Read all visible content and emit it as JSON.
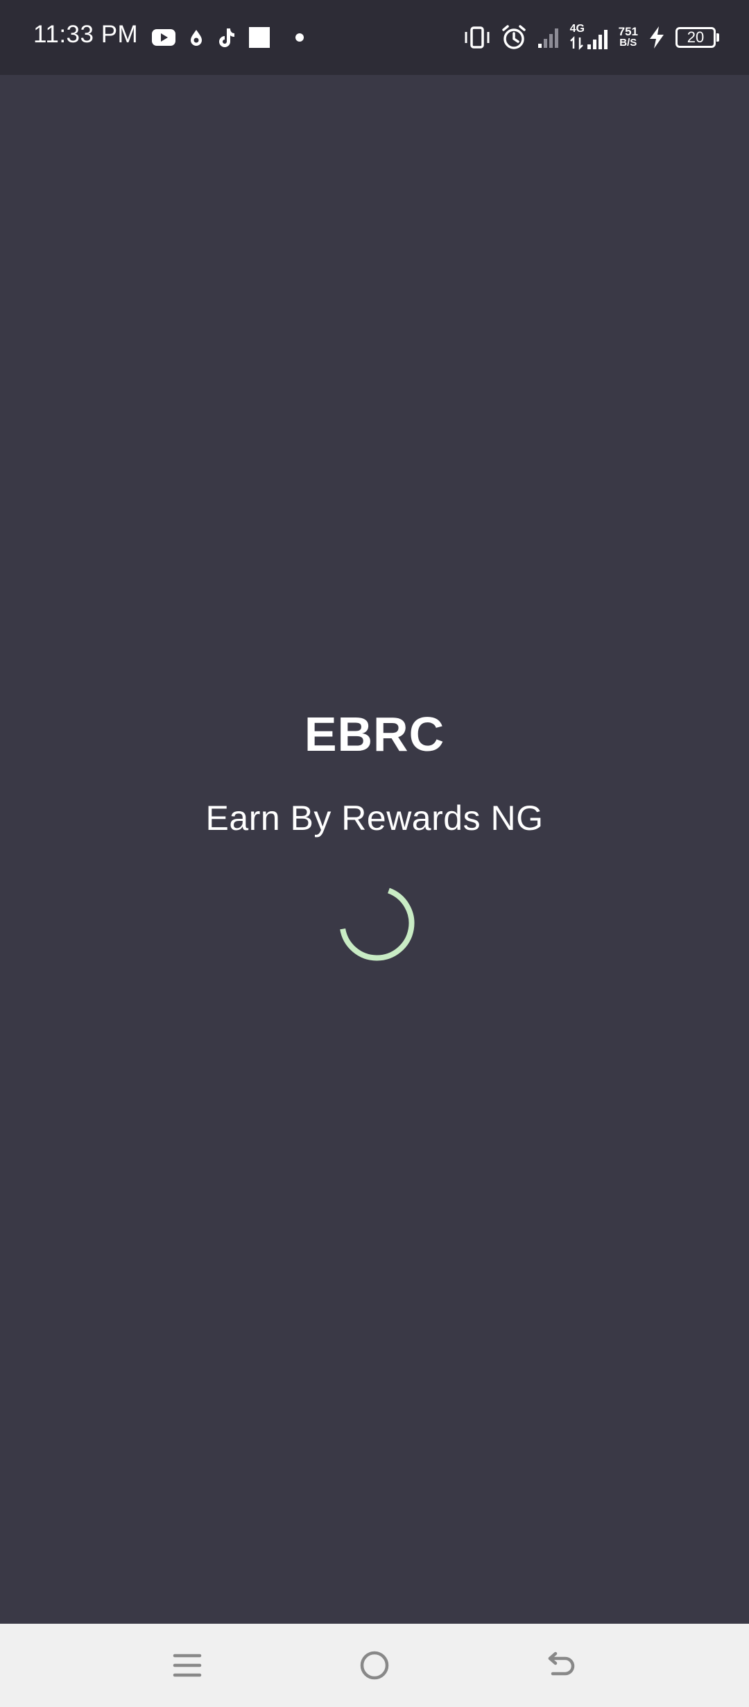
{
  "status_bar": {
    "time": "11:33 PM",
    "network_type": "4G",
    "speed_value": "751",
    "speed_unit": "B/S",
    "battery_level": "20",
    "left_icons": [
      "youtube-icon",
      "notification-drop-icon",
      "tiktok-icon",
      "square-app-icon",
      "more-dot-icon"
    ],
    "right_icons": [
      "vibrate-icon",
      "alarm-icon",
      "signal-icon",
      "signal-4g-icon",
      "charging-icon",
      "battery-icon"
    ]
  },
  "splash": {
    "title": "EBRC",
    "subtitle": "Earn By Rewards NG",
    "spinner_color": "#c9ecc5"
  },
  "nav_bar": {
    "buttons": [
      "menu-icon",
      "home-icon",
      "back-icon"
    ]
  },
  "colors": {
    "background": "#3a3946",
    "status_bar": "#2d2c36",
    "nav_bar": "#f0f0f0"
  }
}
